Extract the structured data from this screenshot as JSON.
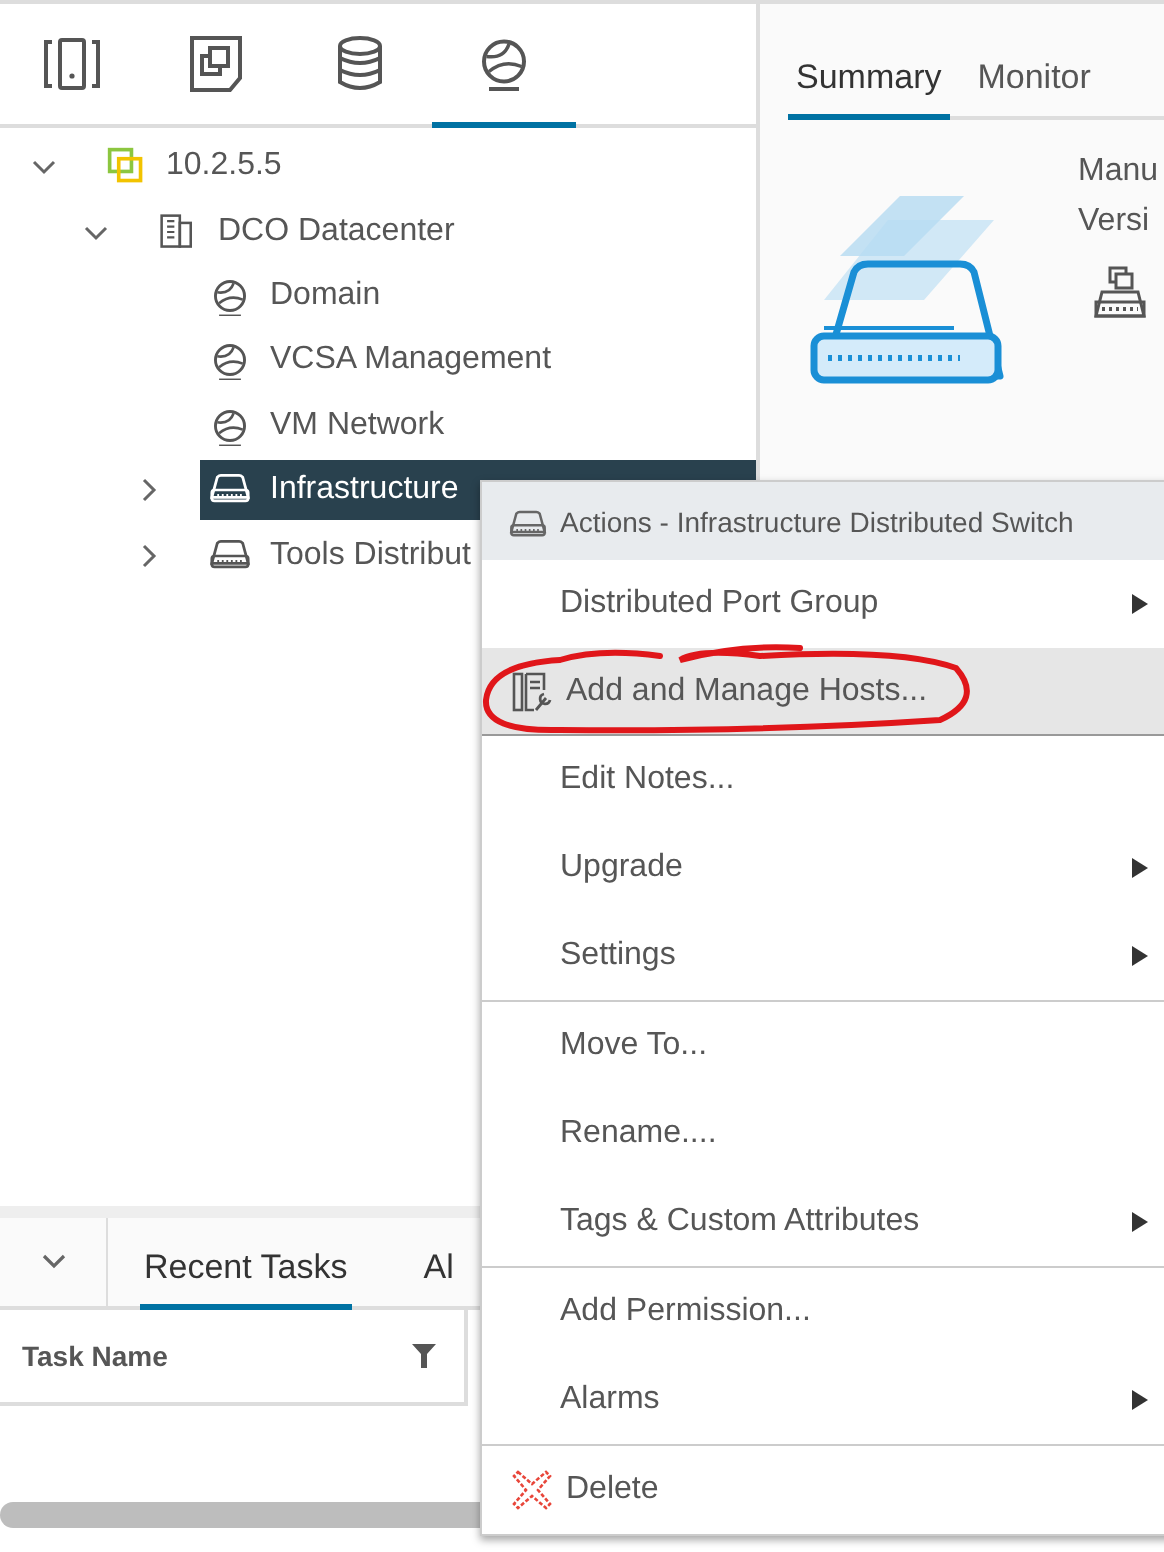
{
  "nav_tabs": [
    {
      "kind": "host",
      "selected": false
    },
    {
      "kind": "vm",
      "selected": false
    },
    {
      "kind": "storage",
      "selected": false
    },
    {
      "kind": "network",
      "selected": true
    }
  ],
  "tree": [
    {
      "label": "10.2.5.5",
      "kind": "vcenter",
      "expanded": true,
      "selected": false,
      "children": [
        {
          "label": "DCO Datacenter",
          "kind": "datacenter",
          "expanded": true,
          "selected": false,
          "children": [
            {
              "label": "Domain",
              "kind": "network",
              "selected": false
            },
            {
              "label": "VCSA Management",
              "kind": "network",
              "selected": false
            },
            {
              "label": "VM Network",
              "kind": "network",
              "selected": false
            },
            {
              "label": "Infrastructure",
              "kind": "switch",
              "expanded": false,
              "selected": true
            },
            {
              "label": "Tools Distribut",
              "kind": "switch",
              "expanded": false,
              "selected": false
            }
          ]
        }
      ]
    }
  ],
  "detail_tabs": [
    {
      "label": "Summary",
      "selected": true
    },
    {
      "label": "Monitor",
      "selected": false
    }
  ],
  "summary": {
    "fields": [
      "Manu",
      "Versi"
    ]
  },
  "bottom_panel": {
    "tabs": [
      {
        "label": "Recent Tasks",
        "selected": true
      },
      {
        "label": "Al",
        "selected": false
      }
    ],
    "columns": [
      "Task Name"
    ]
  },
  "context_menu": {
    "title": "Actions - Infrastructure Distributed Switch",
    "groups": [
      [
        {
          "label": "Distributed Port Group",
          "submenu": true,
          "highlighted": false
        },
        {
          "label": "Add and Manage Hosts...",
          "kind": "hosts",
          "submenu": false,
          "highlighted": true
        },
        {
          "label": "Edit Notes...",
          "submenu": false,
          "highlighted": false
        },
        {
          "label": "Upgrade",
          "submenu": true,
          "highlighted": false
        },
        {
          "label": "Settings",
          "submenu": true,
          "highlighted": false
        }
      ],
      [
        {
          "label": "Move To...",
          "submenu": false,
          "highlighted": false
        },
        {
          "label": "Rename....",
          "submenu": false,
          "highlighted": false
        },
        {
          "label": "Tags & Custom Attributes",
          "submenu": true,
          "highlighted": false
        }
      ],
      [
        {
          "label": "Add Permission...",
          "submenu": false,
          "highlighted": false
        },
        {
          "label": "Alarms",
          "submenu": true,
          "highlighted": false
        }
      ],
      [
        {
          "label": "Delete",
          "kind": "delete",
          "submenu": false,
          "highlighted": false
        }
      ]
    ]
  }
}
